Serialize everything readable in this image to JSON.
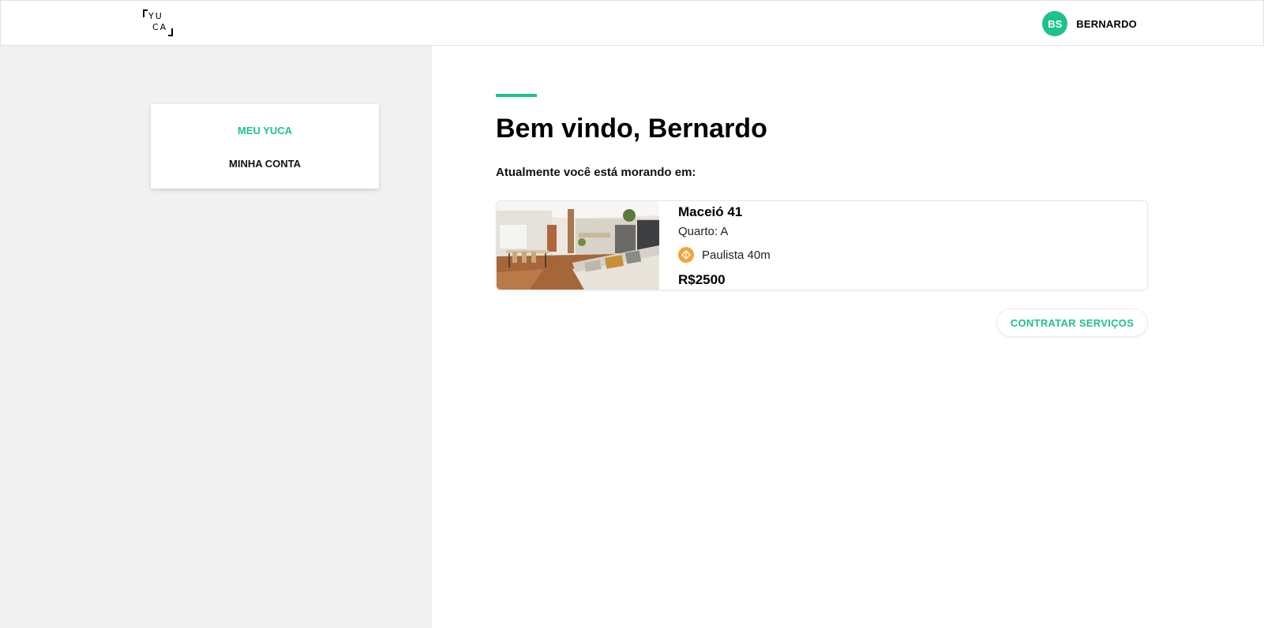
{
  "header": {
    "logo_line1": "YU",
    "logo_line2": "CA",
    "user_initials": "BS",
    "user_name": "BERNARDO"
  },
  "sidebar": {
    "items": [
      {
        "label": "MEU YUCA",
        "active": true
      },
      {
        "label": "MINHA CONTA",
        "active": false
      }
    ]
  },
  "main": {
    "welcome_title": "Bem vindo, Bernardo",
    "living_label": "Atualmente você está morando em:",
    "property": {
      "name": "Maceió 41",
      "room": "Quarto: A",
      "metro": "Paulista 40m",
      "price": "R$2500"
    },
    "hire_button_label": "CONTRATAR SERVIÇOS"
  },
  "colors": {
    "accent": "#1ec28b",
    "metro_icon": "#f5a23c",
    "left_background": "#f1f1f1"
  },
  "icons": {
    "metro": "metro-station-icon",
    "photo": "apartment-photo"
  }
}
